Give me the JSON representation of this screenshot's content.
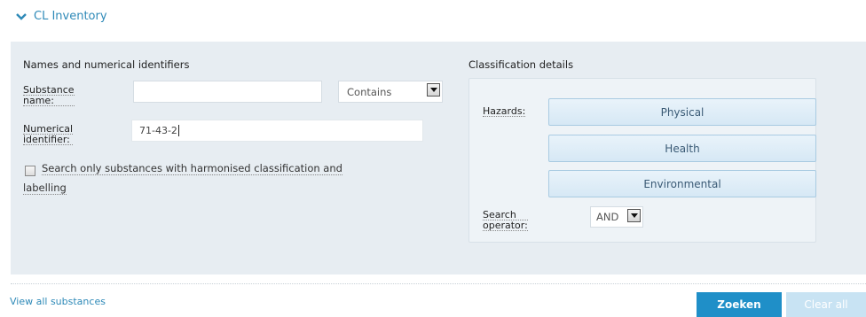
{
  "section": {
    "title": "CL Inventory"
  },
  "names": {
    "heading": "Names and numerical identifiers",
    "substance_label_1": "Substance",
    "substance_label_2": "name:",
    "substance_value": "",
    "match_mode": "Contains",
    "numeric_label_1": "Numerical",
    "numeric_label_2": "identifier:",
    "numeric_value": "71-43-2",
    "harmonised_line1": "Search only substances with harmonised classification and",
    "harmonised_line2": "labelling",
    "harmonised_checked": false
  },
  "classification": {
    "heading": "Classification details",
    "hazards_label": "Hazards:",
    "buttons": [
      "Physical",
      "Health",
      "Environmental"
    ],
    "operator_label_1": "Search",
    "operator_label_2": "operator:",
    "operator_value": "AND"
  },
  "footer": {
    "view_all": "View all substances",
    "search_button": "Zoeken",
    "clear_button": "Clear all"
  },
  "colors": {
    "accent": "#1f8fc8",
    "panel": "#e7edf2",
    "link": "#2f8ab8"
  }
}
